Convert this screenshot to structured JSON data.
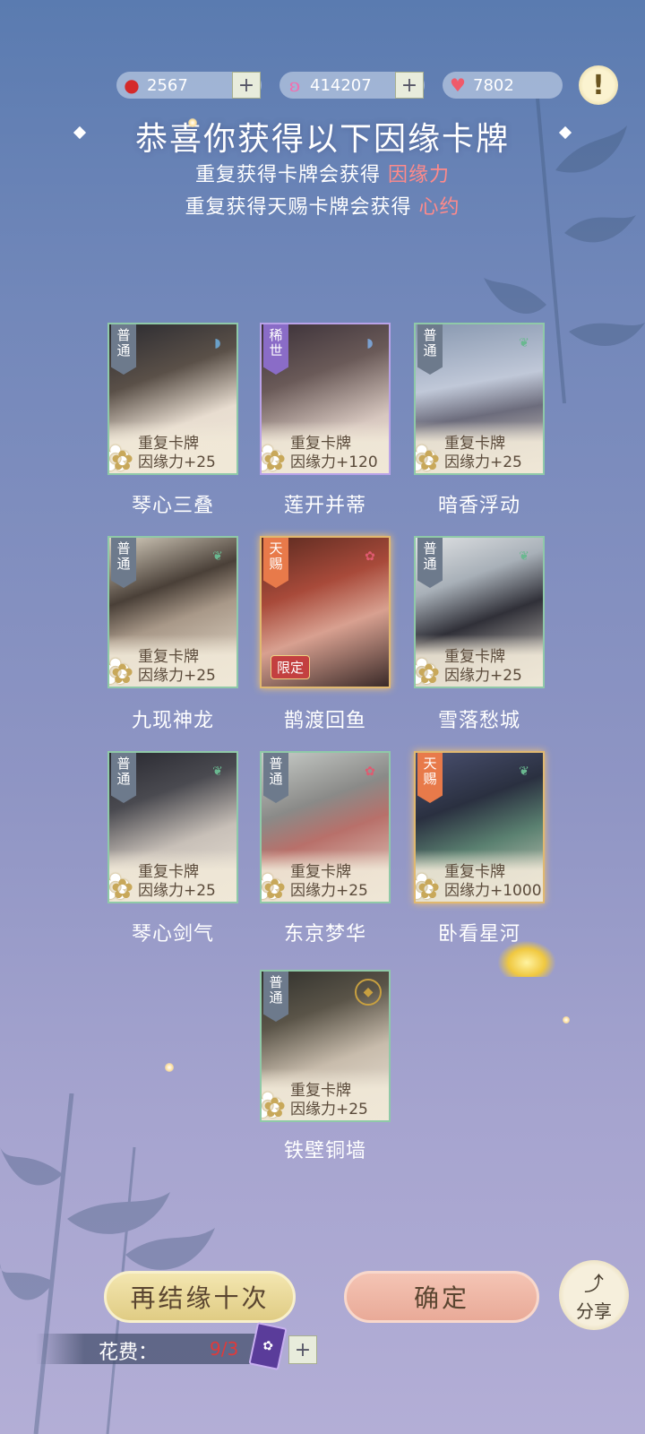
{
  "currency": {
    "beans": {
      "icon": "red-bean-icon",
      "value": "2567"
    },
    "butterfly": {
      "icon": "butterfly-icon",
      "value": "414207"
    },
    "hearts": {
      "icon": "heart-icon",
      "value": "7802"
    }
  },
  "header": {
    "title": "恭喜你获得以下因缘卡牌",
    "line1_prefix": "重复获得卡牌会获得",
    "line1_highlight": "因缘力",
    "line2_prefix": "重复获得天赐卡牌会获得",
    "line2_highlight": "心约"
  },
  "cards": [
    {
      "name": "琴心三叠",
      "rarity": "普通",
      "dup_title": "重复卡牌",
      "dup_reward": "因缘力+25",
      "emblem": "fan-icon"
    },
    {
      "name": "莲开并蒂",
      "rarity": "稀世",
      "dup_title": "重复卡牌",
      "dup_reward": "因缘力+120",
      "emblem": "fan-icon"
    },
    {
      "name": "暗香浮动",
      "rarity": "普通",
      "dup_title": "重复卡牌",
      "dup_reward": "因缘力+25",
      "emblem": "leaf-icon"
    },
    {
      "name": "九现神龙",
      "rarity": "普通",
      "dup_title": "重复卡牌",
      "dup_reward": "因缘力+25",
      "emblem": "leaf-icon"
    },
    {
      "name": "鹊渡回鱼",
      "rarity": "天赐",
      "badge": "限定",
      "emblem": "blossom-icon"
    },
    {
      "name": "雪落愁城",
      "rarity": "普通",
      "dup_title": "重复卡牌",
      "dup_reward": "因缘力+25",
      "emblem": "leaf-icon"
    },
    {
      "name": "琴心剑气",
      "rarity": "普通",
      "dup_title": "重复卡牌",
      "dup_reward": "因缘力+25",
      "emblem": "leaf-icon"
    },
    {
      "name": "东京梦华",
      "rarity": "普通",
      "dup_title": "重复卡牌",
      "dup_reward": "因缘力+25",
      "emblem": "blossom-icon"
    },
    {
      "name": "卧看星河",
      "rarity": "天赐",
      "dup_title": "重复卡牌",
      "dup_reward": "因缘力+1000",
      "emblem": "leaf-icon"
    },
    {
      "name": "铁壁铜墙",
      "rarity": "普通",
      "dup_title": "重复卡牌",
      "dup_reward": "因缘力+25",
      "emblem": "coin-icon"
    }
  ],
  "actions": {
    "retry_label": "再结缘十次",
    "confirm_label": "确定",
    "share_label": "分享"
  },
  "cost": {
    "label": "花费：",
    "value": "9/3"
  },
  "colors": {
    "highlight": "#ff8a8a",
    "common_border": "#8fc9a8",
    "rare_border": "#b9a2e8",
    "gift_border": "#e0b870"
  }
}
